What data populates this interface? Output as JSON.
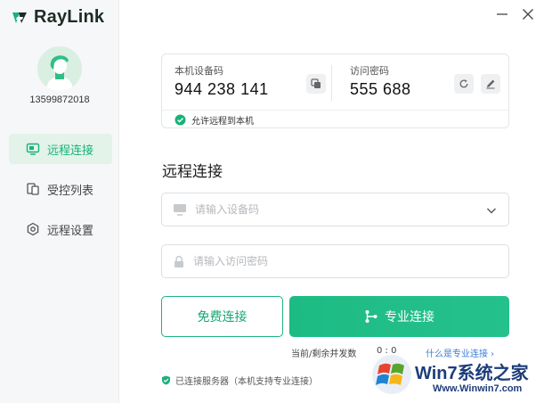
{
  "app": {
    "name": "RayLink",
    "brand_color": "#18b27a"
  },
  "user": {
    "id": "13599872018"
  },
  "sidebar": {
    "items": [
      {
        "label": "远程连接",
        "icon": "monitor-icon",
        "active": true
      },
      {
        "label": "受控列表",
        "icon": "devices-icon",
        "active": false
      },
      {
        "label": "远程设置",
        "icon": "settings-icon",
        "active": false
      }
    ]
  },
  "window": {
    "minimize_icon": "minimize-icon",
    "close_icon": "close-icon"
  },
  "device": {
    "code_label": "本机设备码",
    "code": "944 238 141",
    "password_label": "访问密码",
    "password": "555 688",
    "allow_remote": "允许远程到本机"
  },
  "connect": {
    "title": "远程连接",
    "device_placeholder": "请输入设备码",
    "password_placeholder": "请输入访问密码",
    "free_button": "免费连接",
    "pro_button": "专业连接",
    "concurrent_label": "当前/剩余并发数",
    "concurrent_value": "0 : 0",
    "pro_link": "什么是专业连接 ›"
  },
  "status": {
    "server": "已连接服务器（本机支持专业连接）"
  },
  "watermark": {
    "title": "Win7系统之家",
    "url": "Www.Winwin7.com"
  }
}
